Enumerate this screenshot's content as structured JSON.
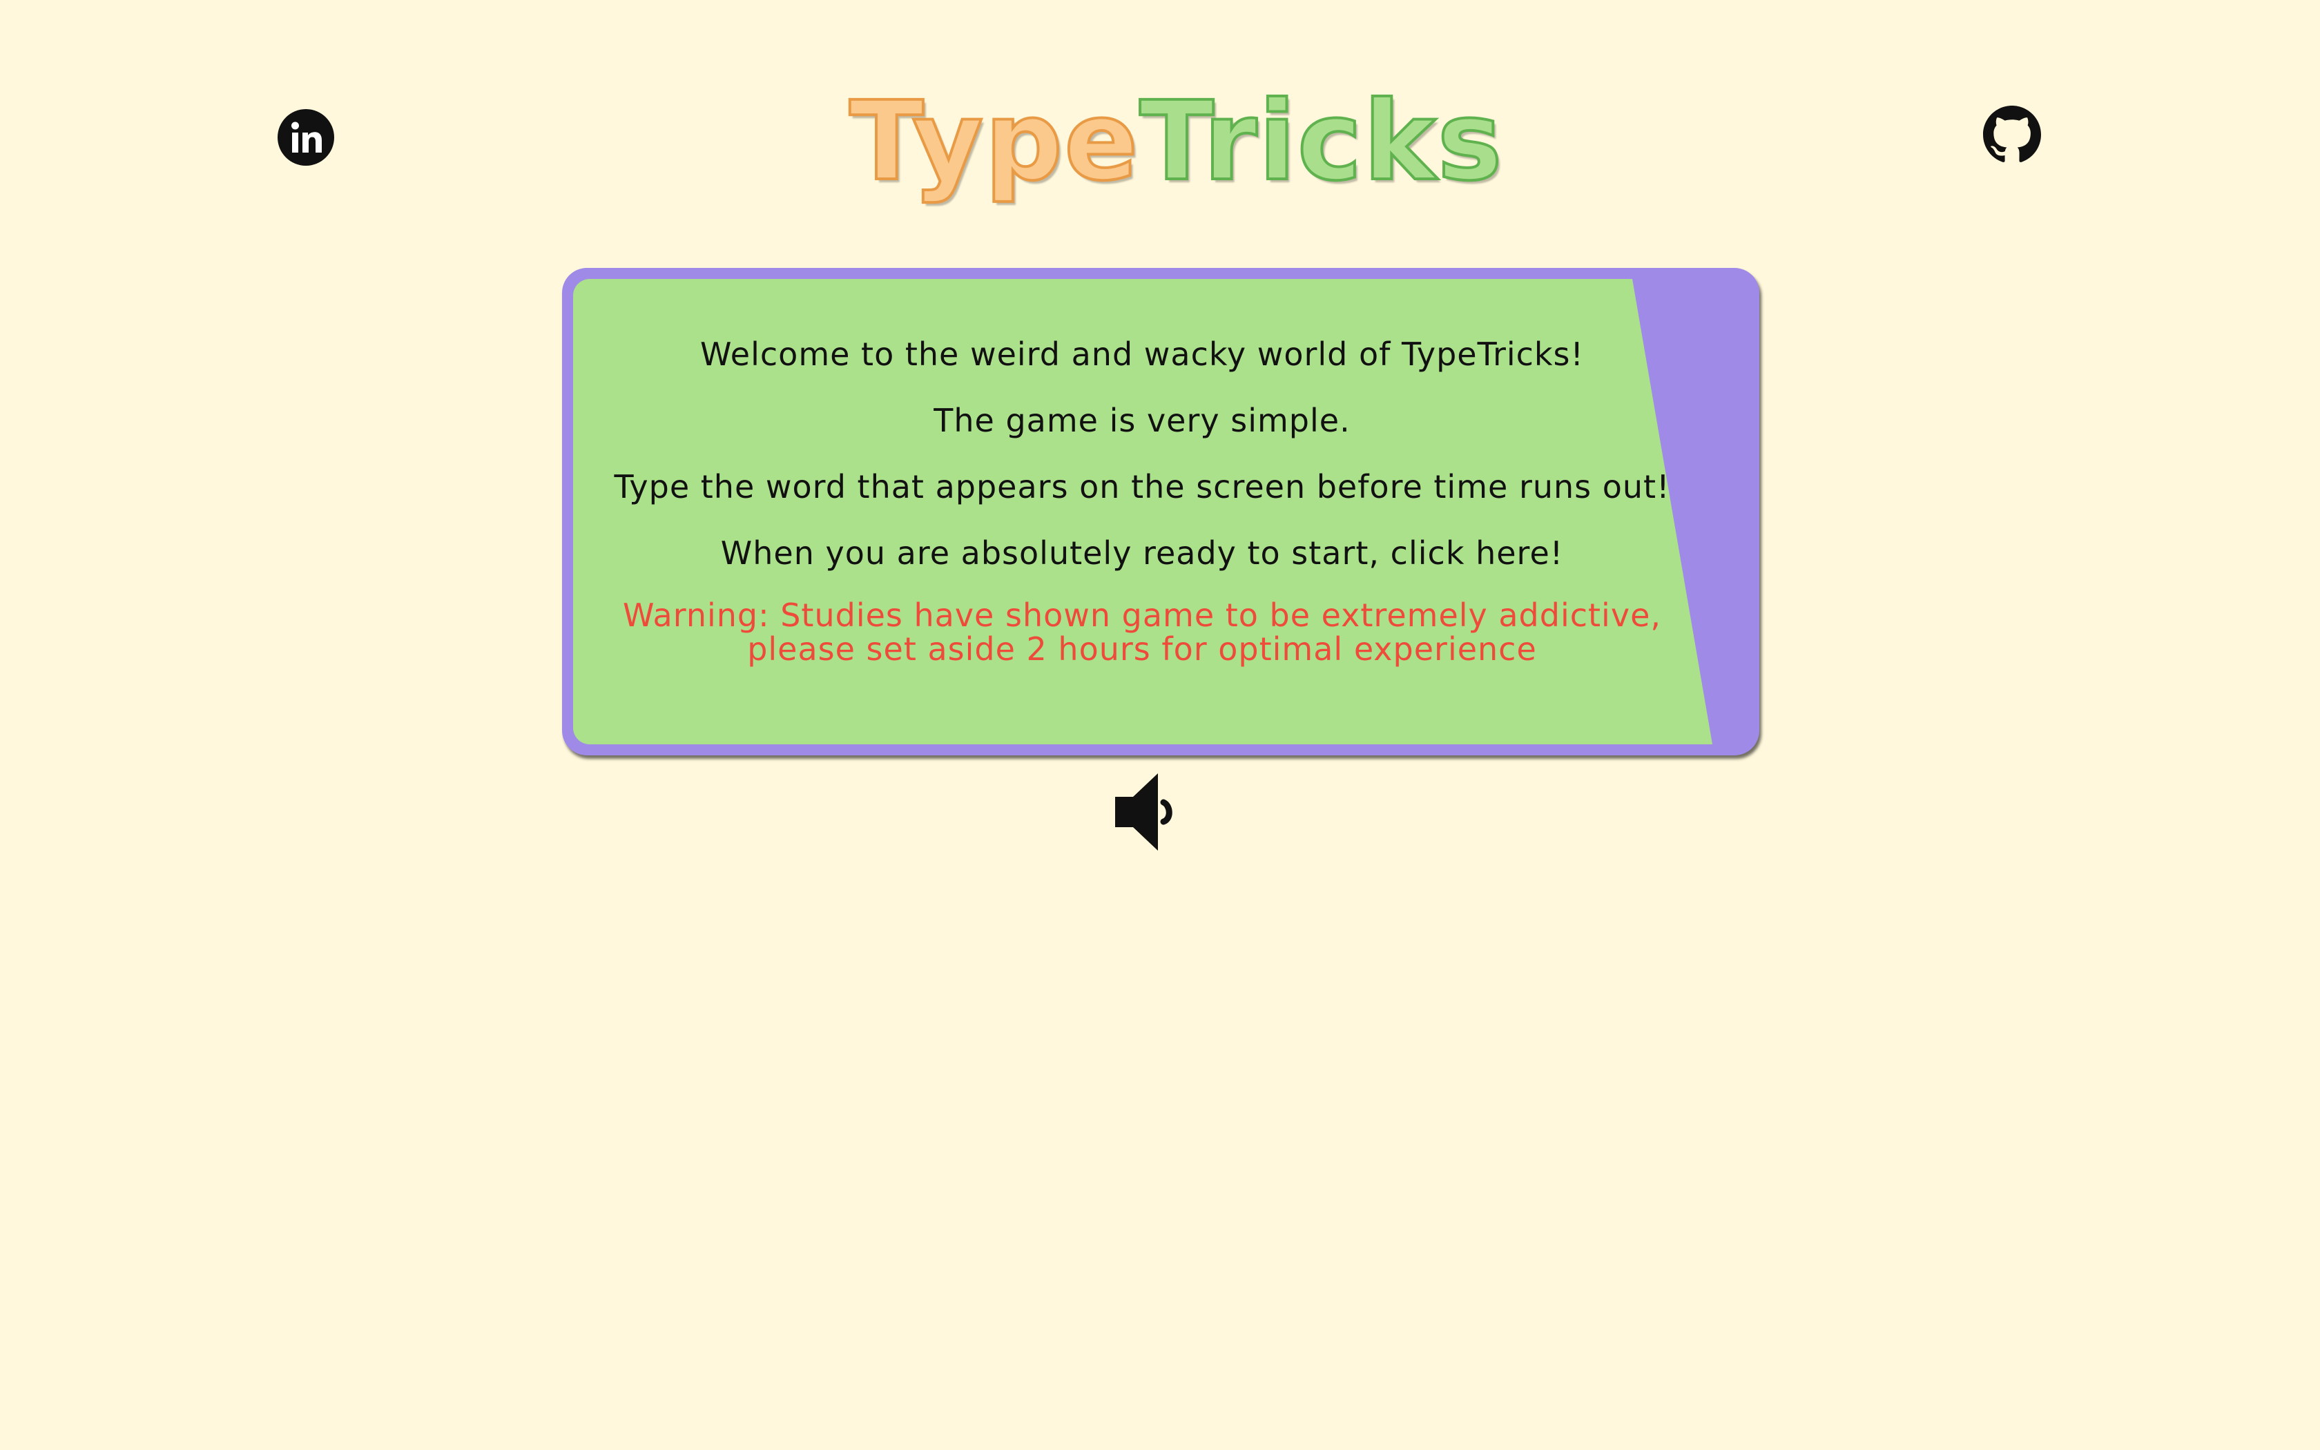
{
  "header": {
    "logo_part1": "Type",
    "logo_part2": "Tricks",
    "linkedin_icon": "linkedin-icon",
    "github_icon": "github-icon"
  },
  "intro": {
    "line1": "Welcome to the weird and wacky world of TypeTricks!",
    "line2": "The game is very simple.",
    "line3": "Type the word that appears on the screen before time runs out!",
    "line4": "When you are absolutely ready to start, click here!",
    "warning": "Warning: Studies have shown game to be extremely addictive, please set aside 2 hours for optimal experience"
  },
  "sound": {
    "icon": "speaker-icon"
  },
  "colors": {
    "background": "#fff8dc",
    "card_border": "#a08ae8",
    "card_fill": "#ace18b",
    "logo_orange": "#fbc98b",
    "logo_green": "#a9df8c",
    "warning": "#ee4b3b"
  }
}
